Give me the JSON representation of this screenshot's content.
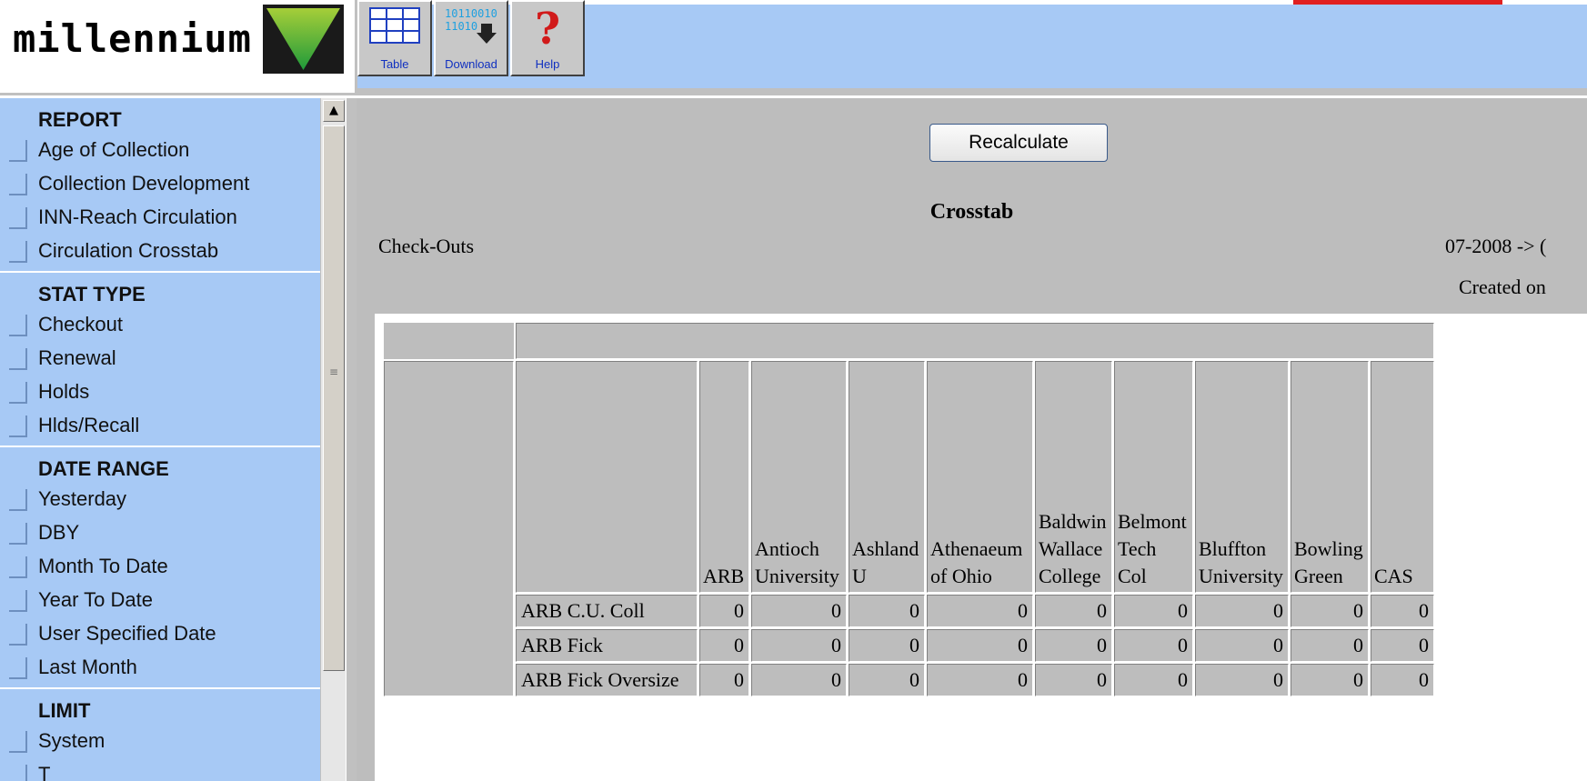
{
  "logo": {
    "text": "millennium"
  },
  "toolbar": {
    "buttons": [
      {
        "label": "Table",
        "icon": "table-grid-icon"
      },
      {
        "label": "Download",
        "icon": "download-binary-icon"
      },
      {
        "label": "Help",
        "icon": "question-mark-icon"
      }
    ]
  },
  "sidebar": {
    "sections": [
      {
        "heading": "REPORT",
        "items": [
          "Age of Collection",
          "Collection Development",
          "INN-Reach Circulation",
          "Circulation Crosstab"
        ]
      },
      {
        "heading": "STAT TYPE",
        "items": [
          "Checkout",
          "Renewal",
          "Holds",
          "Hlds/Recall"
        ]
      },
      {
        "heading": "DATE RANGE",
        "items": [
          "Yesterday",
          "DBY",
          "Month To Date",
          "Year To Date",
          "User Specified Date",
          "Last Month"
        ]
      },
      {
        "heading": "LIMIT",
        "items": [
          "System",
          "T"
        ]
      }
    ]
  },
  "main": {
    "recalculate_label": "Recalculate",
    "title": "Crosstab",
    "stat_label": "Check-Outs",
    "date_range": "07-2008 -> (",
    "created_on": "Created on",
    "columns": [
      "ARB",
      "Antioch University",
      "Ashland U",
      "Athenaeum of Ohio",
      "Baldwin Wallace College",
      "Belmont Tech Col",
      "Bluffton University",
      "Bowling Green",
      "CAS"
    ],
    "rows": [
      {
        "label": "ARB C.U. Coll",
        "values": [
          "0",
          "0",
          "0",
          "0",
          "0",
          "0",
          "0",
          "0",
          "0"
        ]
      },
      {
        "label": "ARB Fick",
        "values": [
          "0",
          "0",
          "0",
          "0",
          "0",
          "0",
          "0",
          "0",
          "0"
        ]
      },
      {
        "label": "ARB Fick Oversize",
        "values": [
          "0",
          "0",
          "0",
          "0",
          "0",
          "0",
          "0",
          "0",
          "0"
        ]
      }
    ]
  },
  "colors": {
    "sidebar_bg": "#a7c9f5",
    "toolbar_bg": "#a7c9f5",
    "main_bg": "#bdbdbd",
    "accent_red": "#e02020"
  }
}
